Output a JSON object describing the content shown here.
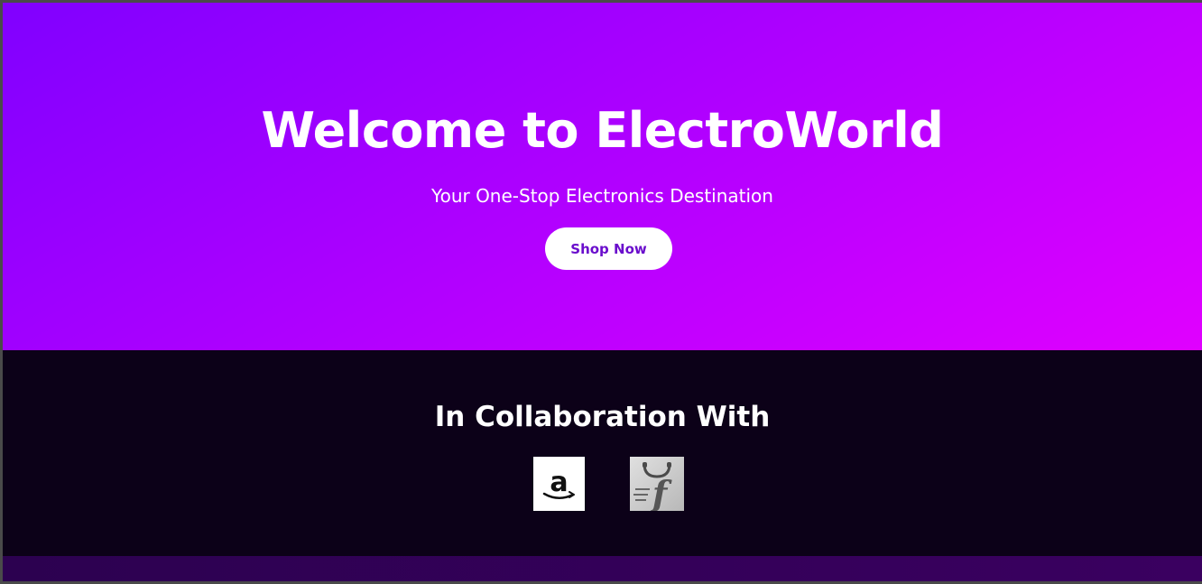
{
  "hero": {
    "title": "Welcome to ElectroWorld",
    "subtitle": "Your One-Stop Electronics Destination",
    "cta_label": "Shop Now"
  },
  "collaboration": {
    "title": "In Collaboration With",
    "partners": [
      {
        "name": "Amazon",
        "icon": "amazon-logo-icon"
      },
      {
        "name": "Flipkart",
        "icon": "flipkart-logo-icon"
      }
    ]
  },
  "colors": {
    "hero_gradient_start": "#8000ff",
    "hero_gradient_end": "#e000ff",
    "collab_background": "#0c0118",
    "button_text": "#6a0dcc",
    "footer_strip": "#2c0150"
  }
}
